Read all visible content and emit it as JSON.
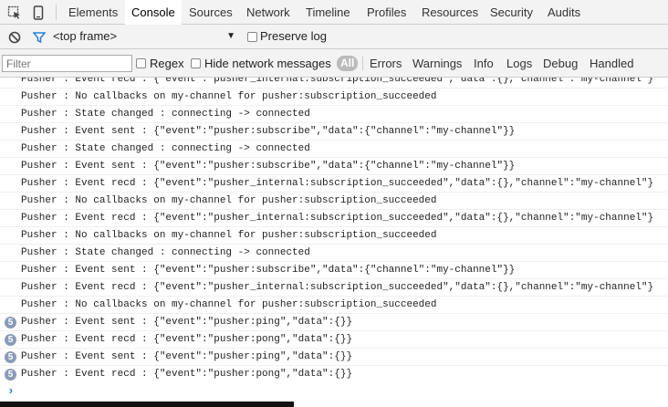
{
  "tabs": [
    {
      "label": "Elements"
    },
    {
      "label": "Console"
    },
    {
      "label": "Sources"
    },
    {
      "label": "Network"
    },
    {
      "label": "Timeline"
    },
    {
      "label": "Profiles"
    },
    {
      "label": "Resources"
    },
    {
      "label": "Security"
    },
    {
      "label": "Audits"
    }
  ],
  "active_tab": "Console",
  "toolbar": {
    "frame_select_value": "<top frame>",
    "preserve_log_label": "Preserve log",
    "filter_placeholder": "Filter",
    "regex_label": "Regex",
    "hide_network_label": "Hide network messages",
    "levels": [
      "All",
      "Errors",
      "Warnings",
      "Info",
      "Logs",
      "Debug",
      "Handled"
    ]
  },
  "log": [
    {
      "text": "Pusher : Event recd : {\"event\":\"pusher_internal:subscription_succeeded\",\"data\":{},\"channel\":\"my-channel\"}",
      "count": ""
    },
    {
      "text": "Pusher : No callbacks on my-channel for pusher:subscription_succeeded",
      "count": ""
    },
    {
      "text": "Pusher : State changed : connecting -> connected",
      "count": ""
    },
    {
      "text": "Pusher : Event sent : {\"event\":\"pusher:subscribe\",\"data\":{\"channel\":\"my-channel\"}}",
      "count": ""
    },
    {
      "text": "Pusher : State changed : connecting -> connected",
      "count": ""
    },
    {
      "text": "Pusher : Event sent : {\"event\":\"pusher:subscribe\",\"data\":{\"channel\":\"my-channel\"}}",
      "count": ""
    },
    {
      "text": "Pusher : Event recd : {\"event\":\"pusher_internal:subscription_succeeded\",\"data\":{},\"channel\":\"my-channel\"}",
      "count": ""
    },
    {
      "text": "Pusher : No callbacks on my-channel for pusher:subscription_succeeded",
      "count": ""
    },
    {
      "text": "Pusher : Event recd : {\"event\":\"pusher_internal:subscription_succeeded\",\"data\":{},\"channel\":\"my-channel\"}",
      "count": ""
    },
    {
      "text": "Pusher : No callbacks on my-channel for pusher:subscription_succeeded",
      "count": ""
    },
    {
      "text": "Pusher : State changed : connecting -> connected",
      "count": ""
    },
    {
      "text": "Pusher : Event sent : {\"event\":\"pusher:subscribe\",\"data\":{\"channel\":\"my-channel\"}}",
      "count": ""
    },
    {
      "text": "Pusher : Event recd : {\"event\":\"pusher_internal:subscription_succeeded\",\"data\":{},\"channel\":\"my-channel\"}",
      "count": ""
    },
    {
      "text": "Pusher : No callbacks on my-channel for pusher:subscription_succeeded",
      "count": ""
    },
    {
      "text": "Pusher : Event sent : {\"event\":\"pusher:ping\",\"data\":{}}",
      "count": "5"
    },
    {
      "text": "Pusher : Event recd : {\"event\":\"pusher:pong\",\"data\":{}}",
      "count": "5"
    },
    {
      "text": "Pusher : Event sent : {\"event\":\"pusher:ping\",\"data\":{}}",
      "count": "5"
    },
    {
      "text": "Pusher : Event recd : {\"event\":\"pusher:pong\",\"data\":{}}",
      "count": "5"
    }
  ],
  "prompt_symbol": "›",
  "colors": {
    "accent": "#2b7fd6",
    "badge": "#8a9bb8",
    "toolbar_bg": "#f3f3f3"
  }
}
